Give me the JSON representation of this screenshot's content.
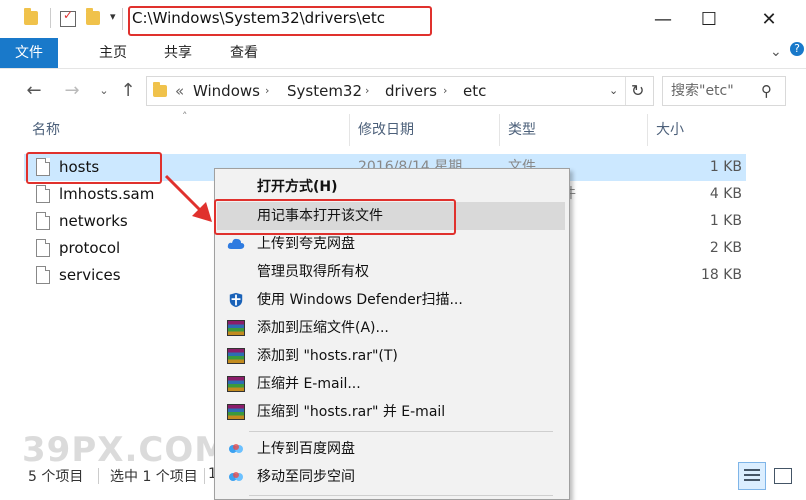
{
  "titlebar": {
    "path": "C:\\Windows\\System32\\drivers\\etc",
    "minimize_glyph": "—",
    "maximize_glyph": "☐",
    "close_glyph": "✕"
  },
  "ribbon": {
    "tabs": [
      {
        "label": "文件"
      },
      {
        "label": "主页"
      },
      {
        "label": "共享"
      },
      {
        "label": "查看"
      }
    ]
  },
  "address": {
    "prefix": "«",
    "crumbs": [
      "Windows",
      "System32",
      "drivers",
      "etc"
    ],
    "search_placeholder": "搜索\"etc\""
  },
  "columns": {
    "name": "名称",
    "date": "修改日期",
    "type": "类型",
    "size": "大小"
  },
  "files": [
    {
      "name": "hosts",
      "date": "2016/8/14 星期",
      "type": "文件",
      "size": "1 KB",
      "selected": true
    },
    {
      "name": "lmhosts.sam",
      "date": "",
      "type": "文件",
      "size": "4 KB",
      "selected": false
    },
    {
      "name": "networks",
      "date": "",
      "type": "",
      "size": "1 KB",
      "selected": false
    },
    {
      "name": "protocol",
      "date": "",
      "type": "",
      "size": "2 KB",
      "selected": false
    },
    {
      "name": "services",
      "date": "",
      "type": "",
      "size": "18 KB",
      "selected": false
    }
  ],
  "context_menu": {
    "items": [
      {
        "label": "打开方式(H)",
        "icon": "none",
        "bold": true
      },
      {
        "label": "用记事本打开该文件",
        "icon": "none",
        "highlighted": true
      },
      {
        "label": "上传到夸克网盘",
        "icon": "cloud-icon"
      },
      {
        "label": "管理员取得所有权",
        "icon": "none"
      },
      {
        "label": "使用 Windows Defender扫描...",
        "icon": "shield-icon"
      },
      {
        "label": "添加到压缩文件(A)...",
        "icon": "winrar-icon"
      },
      {
        "label": "添加到 \"hosts.rar\"(T)",
        "icon": "winrar-icon"
      },
      {
        "label": "压缩并 E-mail...",
        "icon": "winrar-icon"
      },
      {
        "label": "压缩到 \"hosts.rar\" 并 E-mail",
        "icon": "winrar-icon"
      },
      {
        "label": "上传到百度网盘",
        "icon": "baidu-cloud-icon"
      },
      {
        "label": "移动至同步空间",
        "icon": "baidu-cloud-icon"
      }
    ]
  },
  "status": {
    "count": "5 个项目",
    "selected": "选中 1 个项目",
    "extra": "1"
  },
  "watermark": "39PX.COM",
  "colors": {
    "accent": "#1979ca",
    "selection": "#cce8ff",
    "annotation_red": "#e0312d"
  }
}
